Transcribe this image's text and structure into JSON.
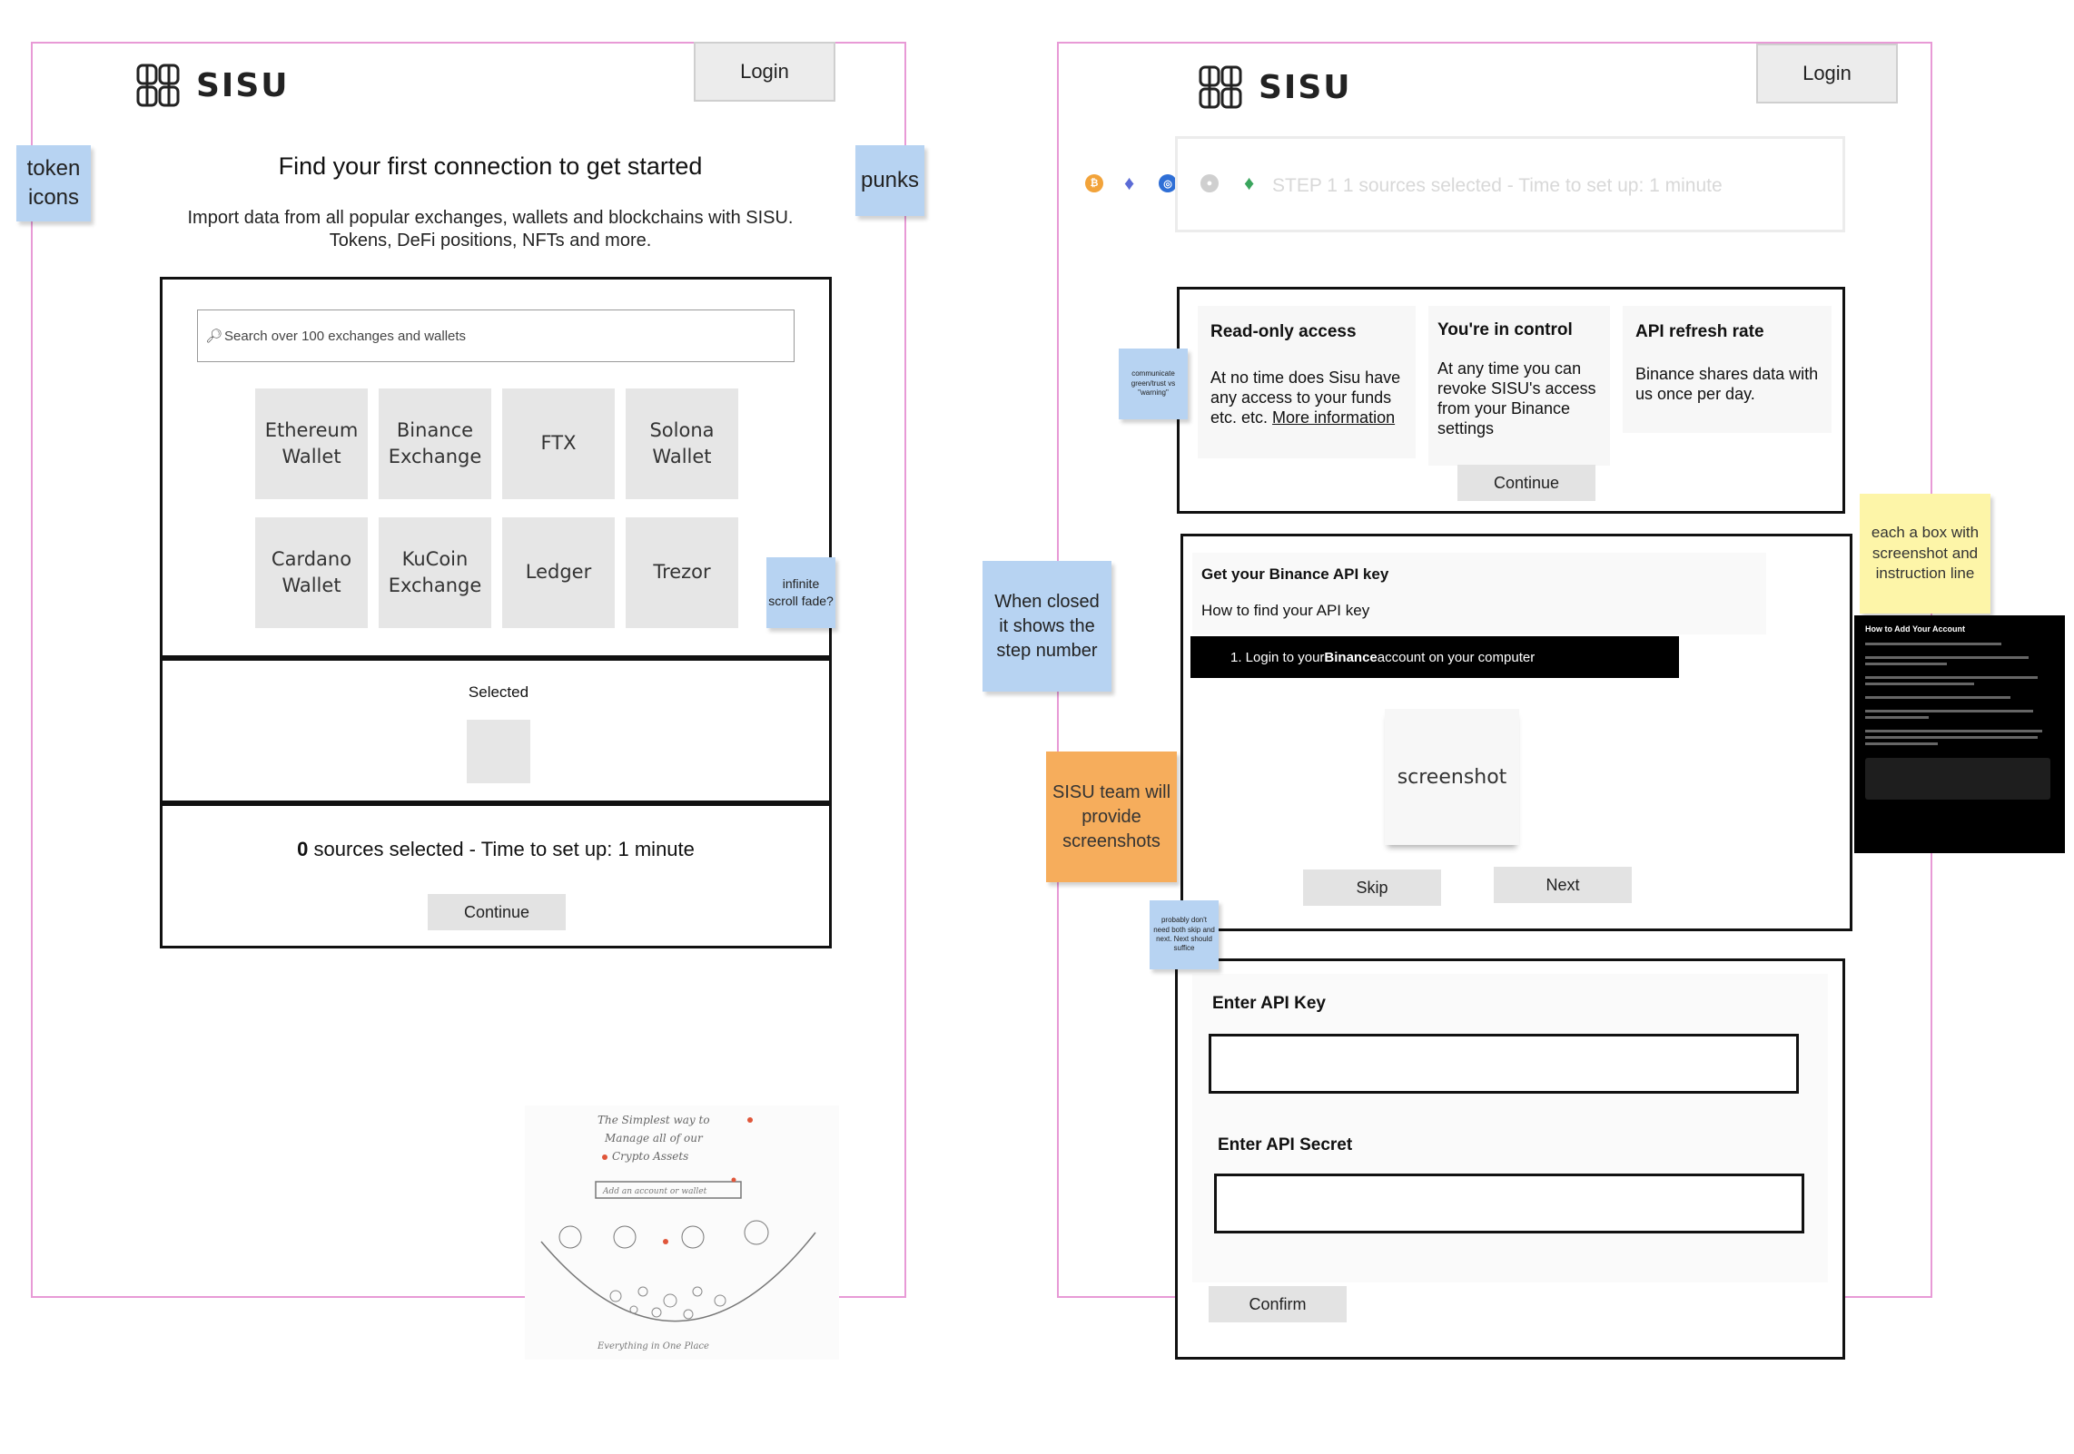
{
  "left": {
    "brand": "SISU",
    "login_label": "Login",
    "heading": "Find your first connection to get started",
    "subheading_line1": "Import data from all popular exchanges, wallets and blockchains with SISU.",
    "subheading_line2": "Tokens, DeFi positions, NFTs and more.",
    "search_placeholder": "Search over 100 exchanges and wallets",
    "tiles": [
      {
        "line1": "Ethereum",
        "line2": "Wallet"
      },
      {
        "line1": "Binance",
        "line2": "Exchange"
      },
      {
        "line1": "FTX",
        "line2": ""
      },
      {
        "line1": "Solona",
        "line2": "Wallet"
      },
      {
        "line1": "Cardano",
        "line2": "Wallet"
      },
      {
        "line1": "KuCoin",
        "line2": "Exchange"
      },
      {
        "line1": "Ledger",
        "line2": ""
      },
      {
        "line1": "Trezor",
        "line2": ""
      }
    ],
    "selected_label": "Selected",
    "sources_count": "0",
    "sources_text": " sources selected - Time to set up: 1 minute",
    "continue_label": "Continue"
  },
  "right": {
    "brand": "SISU",
    "login_label": "Login",
    "step_text": "STEP 1  1 sources selected - Time to set up: 1 minute",
    "info": [
      {
        "title": "Read-only access",
        "body": "At no time does Sisu have any access to your funds etc. etc. ",
        "link": "More information"
      },
      {
        "title": "You're in control",
        "body": "At any time you can revoke SISU's access from your Binance settings",
        "link": ""
      },
      {
        "title": "API refresh rate",
        "body": "Binance shares data with us once per day.",
        "link": ""
      }
    ],
    "info_continue": "Continue",
    "api_title": "Get your Binance API key",
    "api_subtitle": "How to find your API key",
    "instruction_prefix": "1. Login to your ",
    "instruction_bold": "Binance",
    "instruction_suffix": " account on your computer",
    "screenshot_label": "screenshot",
    "skip_label": "Skip",
    "next_label": "Next",
    "key_label": "Enter API Key",
    "secret_label": "Enter API Secret",
    "confirm_label": "Confirm",
    "example_title": "How to Add Your Account"
  },
  "stickies": {
    "token_icons": "token icons",
    "punks": "punks",
    "infinite_scroll": "infinite scroll fade?",
    "communicate": "communicate green/trust vs \"warning\"",
    "when_closed": "When closed it shows the step number",
    "team_screenshots": "SISU team will provide screenshots",
    "skip_next": "probably don't need both skip and next. Next should suffice",
    "each_box": "each a box with screenshot and instruction line"
  },
  "sketch": {
    "line1": "The Simplest way to",
    "line2": "Manage all of our",
    "line3": "Crypto Assets",
    "search": "Add an account or wallet",
    "footer": "Everything in One Place"
  },
  "colors": {
    "frame": "#e89ad6",
    "sticky_blue": "#b7d3f2",
    "sticky_yellow": "#fdf5a8",
    "sticky_orange": "#f6ad5c",
    "btc": "#f2a33a",
    "eth": "#5b6bd6",
    "usdc": "#2f6fd6",
    "neutral": "#cfcfcf",
    "eth_green": "#3aa55d"
  }
}
